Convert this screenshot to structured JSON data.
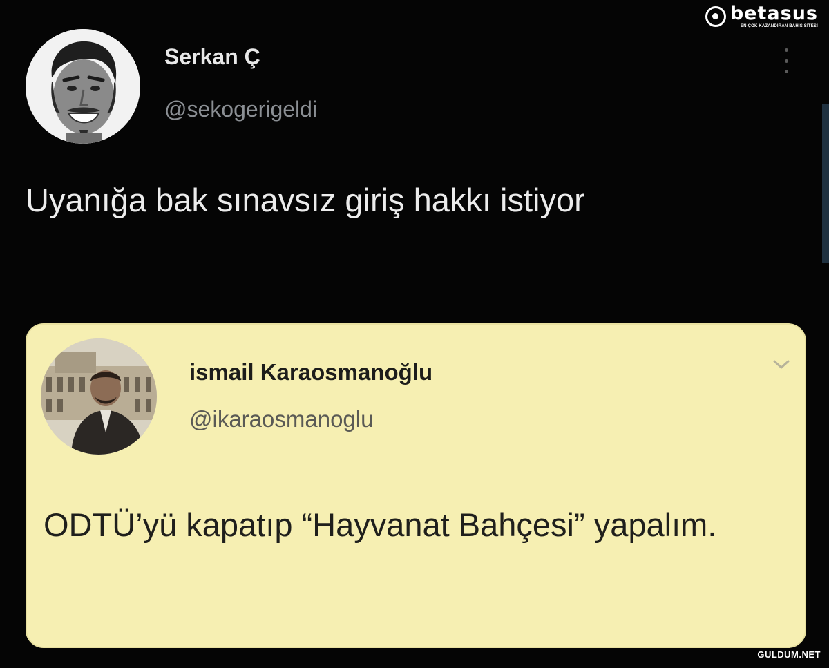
{
  "watermark": {
    "brand": "betasus",
    "tagline": "EN ÇOK KAZANDIRAN BAHİS SİTESİ",
    "footer": "GULDUM.NET"
  },
  "tweet": {
    "author_name": "Serkan Ç",
    "author_handle": "@sekogerigeldi",
    "avatar_icon": "profile-photo-smiling-man",
    "text": "Uyanığa bak sınavsız giriş hakkı istiyor"
  },
  "quoted_tweet": {
    "author_name": "ismail Karaosmanoğlu",
    "author_handle": "@ikaraosmanoglu",
    "avatar_icon": "profile-photo-man-in-suit",
    "text": "ODTÜ’yü kapatıp “Hayvanat Bahçesi” yapalım."
  },
  "colors": {
    "background": "#050505",
    "quote_card": "#f6efb2",
    "handle": "#8b8f94"
  }
}
